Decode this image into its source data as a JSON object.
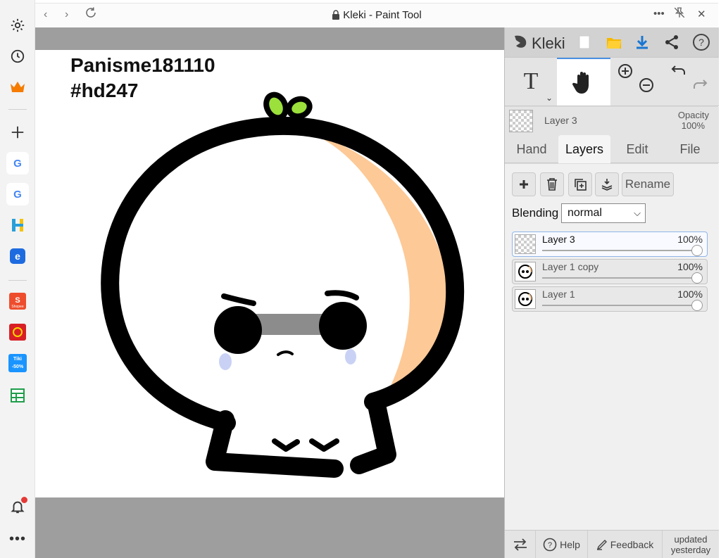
{
  "window": {
    "title": "Kleki - Paint Tool",
    "more_icon": "more-icon",
    "pin_icon": "pin-off-icon",
    "close_icon": "close-icon"
  },
  "edge_sidebar": {
    "items": [
      {
        "name": "settings-icon"
      },
      {
        "name": "history-icon"
      },
      {
        "name": "crown-icon"
      },
      {
        "name": "add-icon"
      },
      {
        "name": "google-app-icon"
      },
      {
        "name": "google-app-icon"
      },
      {
        "name": "h-app-icon"
      },
      {
        "name": "e-app-icon"
      },
      {
        "name": "shopee-app-icon",
        "text": "Shopee"
      },
      {
        "name": "sendo-app-icon"
      },
      {
        "name": "tiki-app-icon",
        "text": "Tiki -50%"
      },
      {
        "name": "sheet-app-icon"
      },
      {
        "name": "bell-icon"
      },
      {
        "name": "more-horizontal-icon"
      }
    ]
  },
  "canvas": {
    "line1": "Panisme181110",
    "line2": "#hd247",
    "colors": {
      "outline": "#000000",
      "skin": "#ffffff",
      "shade": "#fdc996",
      "leaf": "#9be03b",
      "band": "#8c8c8c",
      "tear": "#c9d2f5"
    }
  },
  "panel": {
    "brand": "Kleki",
    "tools": {
      "text_icon": "text-tool-icon",
      "hand_icon": "hand-tool-icon",
      "zoom_in": "zoom-in-icon",
      "zoom_out": "zoom-out-icon",
      "undo": "undo-icon",
      "redo": "redo-icon"
    },
    "current_layer": {
      "name": "Layer 3",
      "opacity_label": "Opacity",
      "opacity_value": "100%"
    },
    "tabs": [
      "Hand",
      "Layers",
      "Edit",
      "File"
    ],
    "active_tab": "Layers",
    "layer_buttons": {
      "rename": "Rename"
    },
    "blending": {
      "label": "Blending",
      "value": "normal"
    },
    "layers": [
      {
        "name": "Layer 3",
        "opacity": "100%",
        "selected": true
      },
      {
        "name": "Layer 1 copy",
        "opacity": "100%",
        "selected": false
      },
      {
        "name": "Layer 1",
        "opacity": "100%",
        "selected": false
      }
    ],
    "footer": {
      "help": "Help",
      "feedback": "Feedback",
      "updated_line1": "updated",
      "updated_line2": "yesterday"
    }
  }
}
